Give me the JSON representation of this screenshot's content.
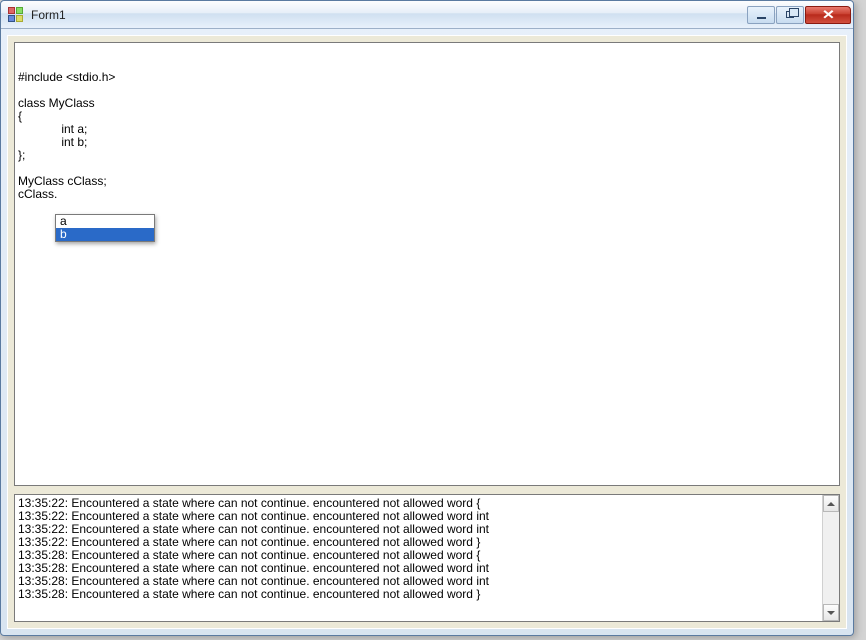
{
  "window": {
    "title": "Form1"
  },
  "editor": {
    "lines": [
      "#include <stdio.h>",
      "",
      "class MyClass",
      "{",
      "             int a;",
      "             int b;",
      "};",
      "",
      "MyClass cClass;",
      "cClass."
    ]
  },
  "autocomplete": {
    "items": [
      {
        "label": "a",
        "selected": false
      },
      {
        "label": "b",
        "selected": true
      }
    ]
  },
  "log": {
    "lines": [
      "13:35:22: Encountered a state where can not continue. encountered not allowed word {",
      "13:35:22: Encountered a state where can not continue. encountered not allowed word int",
      "13:35:22: Encountered a state where can not continue. encountered not allowed word int",
      "13:35:22: Encountered a state where can not continue. encountered not allowed word }",
      "13:35:28: Encountered a state where can not continue. encountered not allowed word {",
      "13:35:28: Encountered a state where can not continue. encountered not allowed word int",
      "13:35:28: Encountered a state where can not continue. encountered not allowed word int",
      "13:35:28: Encountered a state where can not continue. encountered not allowed word }"
    ]
  }
}
